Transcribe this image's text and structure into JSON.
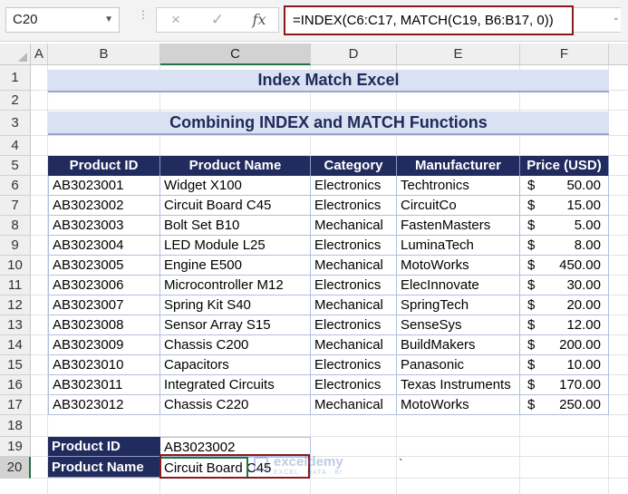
{
  "name_box": "C20",
  "formula_bar": {
    "cancel_icon": "×",
    "enter_icon": "✓",
    "fx_label": "fx",
    "formula": "=INDEX(C6:C17, MATCH(C19, B6:B17, 0))"
  },
  "columns": [
    "A",
    "B",
    "C",
    "D",
    "E",
    "F"
  ],
  "rows": [
    "1",
    "2",
    "3",
    "4",
    "5",
    "6",
    "7",
    "8",
    "9",
    "10",
    "11",
    "12",
    "13",
    "14",
    "15",
    "16",
    "17",
    "18",
    "19",
    "20"
  ],
  "title": "Index Match Excel",
  "subtitle": "Combining INDEX and MATCH Functions",
  "table": {
    "headers": [
      "Product ID",
      "Product Name",
      "Category",
      "Manufacturer",
      "Price (USD)"
    ],
    "currency": "$",
    "rows": [
      [
        "AB3023001",
        "Widget X100",
        "Electronics",
        "Techtronics",
        "50.00"
      ],
      [
        "AB3023002",
        "Circuit Board C45",
        "Electronics",
        "CircuitCo",
        "15.00"
      ],
      [
        "AB3023003",
        "Bolt Set B10",
        "Mechanical",
        "FastenMasters",
        "5.00"
      ],
      [
        "AB3023004",
        "LED Module L25",
        "Electronics",
        "LuminaTech",
        "8.00"
      ],
      [
        "AB3023005",
        "Engine E500",
        "Mechanical",
        "MotoWorks",
        "450.00"
      ],
      [
        "AB3023006",
        "Microcontroller M12",
        "Electronics",
        "ElecInnovate",
        "30.00"
      ],
      [
        "AB3023007",
        "Spring Kit S40",
        "Mechanical",
        "SpringTech",
        "20.00"
      ],
      [
        "AB3023008",
        "Sensor Array S15",
        "Electronics",
        "SenseSys",
        "12.00"
      ],
      [
        "AB3023009",
        "Chassis C200",
        "Mechanical",
        "BuildMakers",
        "200.00"
      ],
      [
        "AB3023010",
        "Capacitors",
        "Electronics",
        "Panasonic",
        "10.00"
      ],
      [
        "AB3023011",
        "Integrated Circuits",
        "Electronics",
        "Texas Instruments",
        "170.00"
      ],
      [
        "AB3023012",
        "Chassis C220",
        "Mechanical",
        "MotoWorks",
        "250.00"
      ]
    ]
  },
  "lookup": {
    "id_label": "Product ID",
    "id_value": "AB3023002",
    "name_label": "Product Name",
    "name_value": "Circuit Board C45"
  },
  "stray_mark": "`",
  "watermark": {
    "brand": "exceldemy",
    "tagline": "EXCEL · DATA · BI"
  },
  "colors": {
    "header_fill": "#222b5e",
    "title_fill": "#d9e1f2",
    "highlight_border": "#8b1a1a",
    "selection": "#217346"
  }
}
